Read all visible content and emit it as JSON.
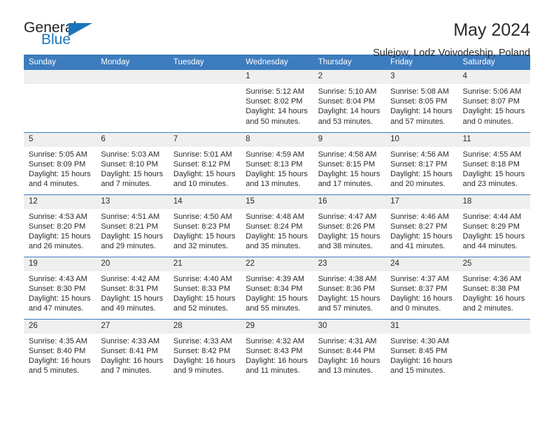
{
  "brand": {
    "logo_top": "General",
    "logo_bottom": "Blue",
    "accent_color": "#1b75bb",
    "triangle_icon": "triangle-icon"
  },
  "header": {
    "title": "May 2024",
    "subtitle": "Sulejow, Lodz Voivodeship, Poland"
  },
  "calendar": {
    "header_bg": "#3c7cbf",
    "daynum_bg": "#efefef",
    "weekday_headers": [
      "Sunday",
      "Monday",
      "Tuesday",
      "Wednesday",
      "Thursday",
      "Friday",
      "Saturday"
    ],
    "weeks": [
      [
        {
          "day": "",
          "empty": true,
          "sunrise": "",
          "sunset": "",
          "daylight1": "",
          "daylight2": ""
        },
        {
          "day": "",
          "empty": true,
          "sunrise": "",
          "sunset": "",
          "daylight1": "",
          "daylight2": ""
        },
        {
          "day": "",
          "empty": true,
          "sunrise": "",
          "sunset": "",
          "daylight1": "",
          "daylight2": ""
        },
        {
          "day": "1",
          "empty": false,
          "sunrise": "Sunrise: 5:12 AM",
          "sunset": "Sunset: 8:02 PM",
          "daylight1": "Daylight: 14 hours",
          "daylight2": "and 50 minutes."
        },
        {
          "day": "2",
          "empty": false,
          "sunrise": "Sunrise: 5:10 AM",
          "sunset": "Sunset: 8:04 PM",
          "daylight1": "Daylight: 14 hours",
          "daylight2": "and 53 minutes."
        },
        {
          "day": "3",
          "empty": false,
          "sunrise": "Sunrise: 5:08 AM",
          "sunset": "Sunset: 8:05 PM",
          "daylight1": "Daylight: 14 hours",
          "daylight2": "and 57 minutes."
        },
        {
          "day": "4",
          "empty": false,
          "sunrise": "Sunrise: 5:06 AM",
          "sunset": "Sunset: 8:07 PM",
          "daylight1": "Daylight: 15 hours",
          "daylight2": "and 0 minutes."
        }
      ],
      [
        {
          "day": "5",
          "empty": false,
          "sunrise": "Sunrise: 5:05 AM",
          "sunset": "Sunset: 8:09 PM",
          "daylight1": "Daylight: 15 hours",
          "daylight2": "and 4 minutes."
        },
        {
          "day": "6",
          "empty": false,
          "sunrise": "Sunrise: 5:03 AM",
          "sunset": "Sunset: 8:10 PM",
          "daylight1": "Daylight: 15 hours",
          "daylight2": "and 7 minutes."
        },
        {
          "day": "7",
          "empty": false,
          "sunrise": "Sunrise: 5:01 AM",
          "sunset": "Sunset: 8:12 PM",
          "daylight1": "Daylight: 15 hours",
          "daylight2": "and 10 minutes."
        },
        {
          "day": "8",
          "empty": false,
          "sunrise": "Sunrise: 4:59 AM",
          "sunset": "Sunset: 8:13 PM",
          "daylight1": "Daylight: 15 hours",
          "daylight2": "and 13 minutes."
        },
        {
          "day": "9",
          "empty": false,
          "sunrise": "Sunrise: 4:58 AM",
          "sunset": "Sunset: 8:15 PM",
          "daylight1": "Daylight: 15 hours",
          "daylight2": "and 17 minutes."
        },
        {
          "day": "10",
          "empty": false,
          "sunrise": "Sunrise: 4:56 AM",
          "sunset": "Sunset: 8:17 PM",
          "daylight1": "Daylight: 15 hours",
          "daylight2": "and 20 minutes."
        },
        {
          "day": "11",
          "empty": false,
          "sunrise": "Sunrise: 4:55 AM",
          "sunset": "Sunset: 8:18 PM",
          "daylight1": "Daylight: 15 hours",
          "daylight2": "and 23 minutes."
        }
      ],
      [
        {
          "day": "12",
          "empty": false,
          "sunrise": "Sunrise: 4:53 AM",
          "sunset": "Sunset: 8:20 PM",
          "daylight1": "Daylight: 15 hours",
          "daylight2": "and 26 minutes."
        },
        {
          "day": "13",
          "empty": false,
          "sunrise": "Sunrise: 4:51 AM",
          "sunset": "Sunset: 8:21 PM",
          "daylight1": "Daylight: 15 hours",
          "daylight2": "and 29 minutes."
        },
        {
          "day": "14",
          "empty": false,
          "sunrise": "Sunrise: 4:50 AM",
          "sunset": "Sunset: 8:23 PM",
          "daylight1": "Daylight: 15 hours",
          "daylight2": "and 32 minutes."
        },
        {
          "day": "15",
          "empty": false,
          "sunrise": "Sunrise: 4:48 AM",
          "sunset": "Sunset: 8:24 PM",
          "daylight1": "Daylight: 15 hours",
          "daylight2": "and 35 minutes."
        },
        {
          "day": "16",
          "empty": false,
          "sunrise": "Sunrise: 4:47 AM",
          "sunset": "Sunset: 8:26 PM",
          "daylight1": "Daylight: 15 hours",
          "daylight2": "and 38 minutes."
        },
        {
          "day": "17",
          "empty": false,
          "sunrise": "Sunrise: 4:46 AM",
          "sunset": "Sunset: 8:27 PM",
          "daylight1": "Daylight: 15 hours",
          "daylight2": "and 41 minutes."
        },
        {
          "day": "18",
          "empty": false,
          "sunrise": "Sunrise: 4:44 AM",
          "sunset": "Sunset: 8:29 PM",
          "daylight1": "Daylight: 15 hours",
          "daylight2": "and 44 minutes."
        }
      ],
      [
        {
          "day": "19",
          "empty": false,
          "sunrise": "Sunrise: 4:43 AM",
          "sunset": "Sunset: 8:30 PM",
          "daylight1": "Daylight: 15 hours",
          "daylight2": "and 47 minutes."
        },
        {
          "day": "20",
          "empty": false,
          "sunrise": "Sunrise: 4:42 AM",
          "sunset": "Sunset: 8:31 PM",
          "daylight1": "Daylight: 15 hours",
          "daylight2": "and 49 minutes."
        },
        {
          "day": "21",
          "empty": false,
          "sunrise": "Sunrise: 4:40 AM",
          "sunset": "Sunset: 8:33 PM",
          "daylight1": "Daylight: 15 hours",
          "daylight2": "and 52 minutes."
        },
        {
          "day": "22",
          "empty": false,
          "sunrise": "Sunrise: 4:39 AM",
          "sunset": "Sunset: 8:34 PM",
          "daylight1": "Daylight: 15 hours",
          "daylight2": "and 55 minutes."
        },
        {
          "day": "23",
          "empty": false,
          "sunrise": "Sunrise: 4:38 AM",
          "sunset": "Sunset: 8:36 PM",
          "daylight1": "Daylight: 15 hours",
          "daylight2": "and 57 minutes."
        },
        {
          "day": "24",
          "empty": false,
          "sunrise": "Sunrise: 4:37 AM",
          "sunset": "Sunset: 8:37 PM",
          "daylight1": "Daylight: 16 hours",
          "daylight2": "and 0 minutes."
        },
        {
          "day": "25",
          "empty": false,
          "sunrise": "Sunrise: 4:36 AM",
          "sunset": "Sunset: 8:38 PM",
          "daylight1": "Daylight: 16 hours",
          "daylight2": "and 2 minutes."
        }
      ],
      [
        {
          "day": "26",
          "empty": false,
          "sunrise": "Sunrise: 4:35 AM",
          "sunset": "Sunset: 8:40 PM",
          "daylight1": "Daylight: 16 hours",
          "daylight2": "and 5 minutes."
        },
        {
          "day": "27",
          "empty": false,
          "sunrise": "Sunrise: 4:33 AM",
          "sunset": "Sunset: 8:41 PM",
          "daylight1": "Daylight: 16 hours",
          "daylight2": "and 7 minutes."
        },
        {
          "day": "28",
          "empty": false,
          "sunrise": "Sunrise: 4:33 AM",
          "sunset": "Sunset: 8:42 PM",
          "daylight1": "Daylight: 16 hours",
          "daylight2": "and 9 minutes."
        },
        {
          "day": "29",
          "empty": false,
          "sunrise": "Sunrise: 4:32 AM",
          "sunset": "Sunset: 8:43 PM",
          "daylight1": "Daylight: 16 hours",
          "daylight2": "and 11 minutes."
        },
        {
          "day": "30",
          "empty": false,
          "sunrise": "Sunrise: 4:31 AM",
          "sunset": "Sunset: 8:44 PM",
          "daylight1": "Daylight: 16 hours",
          "daylight2": "and 13 minutes."
        },
        {
          "day": "31",
          "empty": false,
          "sunrise": "Sunrise: 4:30 AM",
          "sunset": "Sunset: 8:45 PM",
          "daylight1": "Daylight: 16 hours",
          "daylight2": "and 15 minutes."
        },
        {
          "day": "",
          "empty": true,
          "sunrise": "",
          "sunset": "",
          "daylight1": "",
          "daylight2": ""
        }
      ]
    ]
  }
}
